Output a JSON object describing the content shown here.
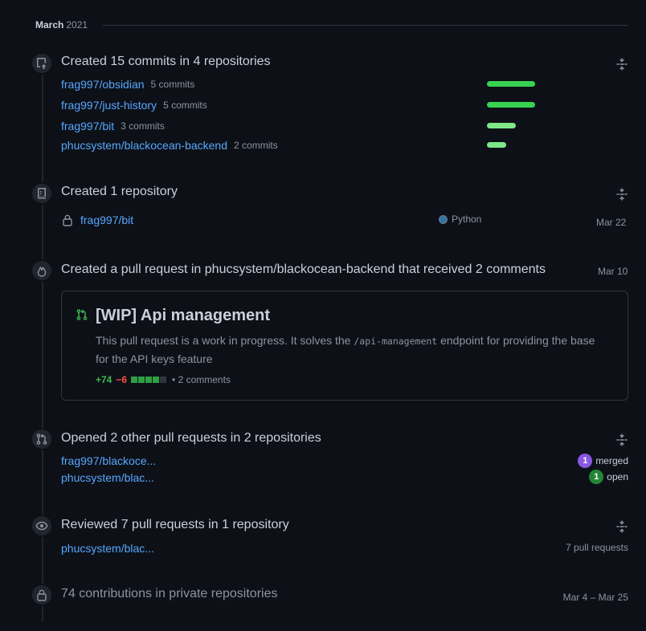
{
  "month": {
    "name": "March",
    "year": "2021"
  },
  "commits_section": {
    "title": "Created 15 commits in 4 repositories",
    "rows": [
      {
        "repo": "frag997/obsidian",
        "count": "5 commits",
        "share": 5
      },
      {
        "repo": "frag997/just-history",
        "count": "5 commits",
        "share": 5
      },
      {
        "repo": "frag997/bit",
        "count": "3 commits",
        "share": 3
      },
      {
        "repo": "phucsystem/blackocean-backend",
        "count": "2 commits",
        "share": 2
      }
    ]
  },
  "repo_section": {
    "title": "Created 1 repository",
    "repo": "frag997/bit",
    "language": "Python",
    "language_color": "#3572A5",
    "date": "Mar 22"
  },
  "pr_section": {
    "title": "Created a pull request in phucsystem/blackocean-backend that received 2 comments",
    "date": "Mar 10",
    "card": {
      "title": "[WIP] Api management",
      "body_before": "This pull request is a work in progress. It solves the ",
      "body_code": "/api-management",
      "body_after": " endpoint for providing the base for the API keys feature",
      "additions": "+74",
      "deletions": "−6",
      "comments": "• 2 comments"
    }
  },
  "opened_section": {
    "title": "Opened 2 other pull requests in 2 repositories",
    "rows": [
      {
        "repo": "frag997/blackoce...",
        "count": "1",
        "state": "merged"
      },
      {
        "repo": "phucsystem/blac...",
        "count": "1",
        "state": "open"
      }
    ]
  },
  "reviewed_section": {
    "title": "Reviewed 7 pull requests in 1 repository",
    "repo": "phucsystem/blac...",
    "count": "7 pull requests"
  },
  "private_section": {
    "title": "74 contributions in private repositories",
    "date_range": "Mar 4 – Mar 25"
  },
  "colors": {
    "link": "#58a6ff",
    "merged": "#8957e5",
    "open": "#238636",
    "additions": "#3fb950",
    "deletions": "#f85149",
    "commit_bar": "#39d353"
  }
}
